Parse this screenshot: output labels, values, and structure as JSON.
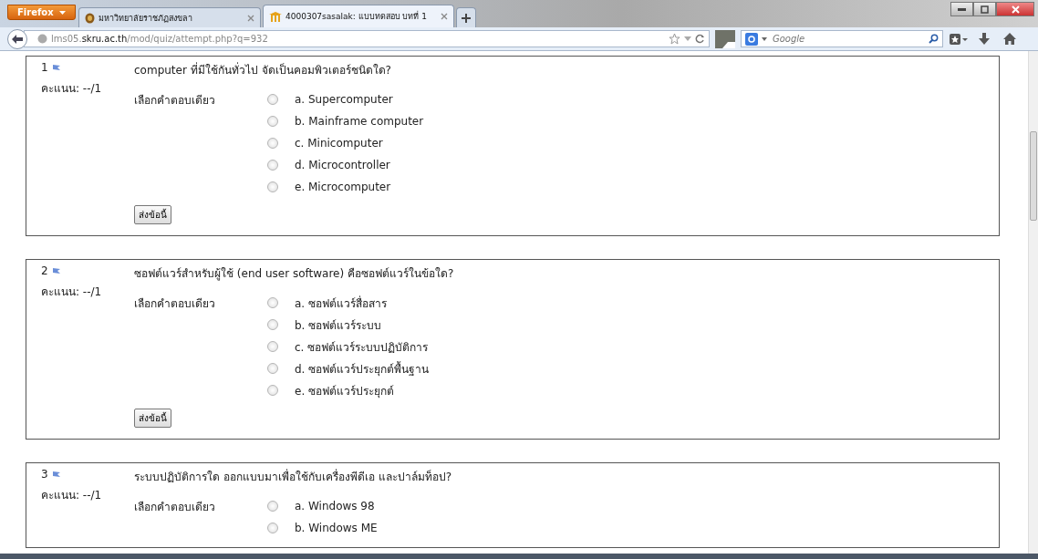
{
  "browser": {
    "menu_button": "Firefox",
    "tabs": [
      {
        "title": "มหาวิทยาลัยราชภัฏสงขลา",
        "selected": false
      },
      {
        "title": "4000307sasalak: แบบทดสอบ บทที่ 1",
        "selected": true
      }
    ],
    "url": {
      "prefix": "lms05.",
      "domain": "skru.ac.th",
      "path": "/mod/quiz/attempt.php?q=932"
    },
    "search": {
      "placeholder": "Google"
    }
  },
  "questions": [
    {
      "number": "1",
      "text": "computer ที่มีใช้กันทั่วไป จัดเป็นคอมพิวเตอร์ชนิดใด?",
      "score": "คะแนน: --/1",
      "prompt": "เลือกคำตอบเดียว",
      "submit": "ส่งข้อนี้",
      "options": [
        {
          "label": "a. Supercomputer",
          "selected": false
        },
        {
          "label": "b. Mainframe computer",
          "selected": false
        },
        {
          "label": "c. Minicomputer",
          "selected": false
        },
        {
          "label": "d. Microcontroller",
          "selected": false
        },
        {
          "label": "e. Microcomputer",
          "selected": false
        }
      ]
    },
    {
      "number": "2",
      "text": "ซอฟต์แวร์สำหรับผู้ใช้ (end user software) คือซอฟต์แวร์ในข้อใด?",
      "score": "คะแนน: --/1",
      "prompt": "เลือกคำตอบเดียว",
      "submit": "ส่งข้อนี้",
      "options": [
        {
          "label": "a. ซอฟต์แวร์สื่อสาร",
          "selected": false
        },
        {
          "label": "b. ซอฟต์แวร์ระบบ",
          "selected": false
        },
        {
          "label": "c. ซอฟต์แวร์ระบบปฏิบัติการ",
          "selected": false
        },
        {
          "label": "d. ซอฟต์แวร์ประยุกต์พื้นฐาน",
          "selected": false
        },
        {
          "label": "e. ซอฟต์แวร์ประยุกต์",
          "selected": false
        }
      ]
    },
    {
      "number": "3",
      "text": "ระบบปฏิบัติการใด ออกแบบมาเพื่อใช้กับเครื่องพีดีเอ และปาล์มท็อป?",
      "score": "คะแนน: --/1",
      "prompt": "เลือกคำตอบเดียว",
      "options": [
        {
          "label": "a. Windows 98",
          "selected": false
        },
        {
          "label": "b. Windows ME",
          "selected": false
        }
      ]
    }
  ]
}
